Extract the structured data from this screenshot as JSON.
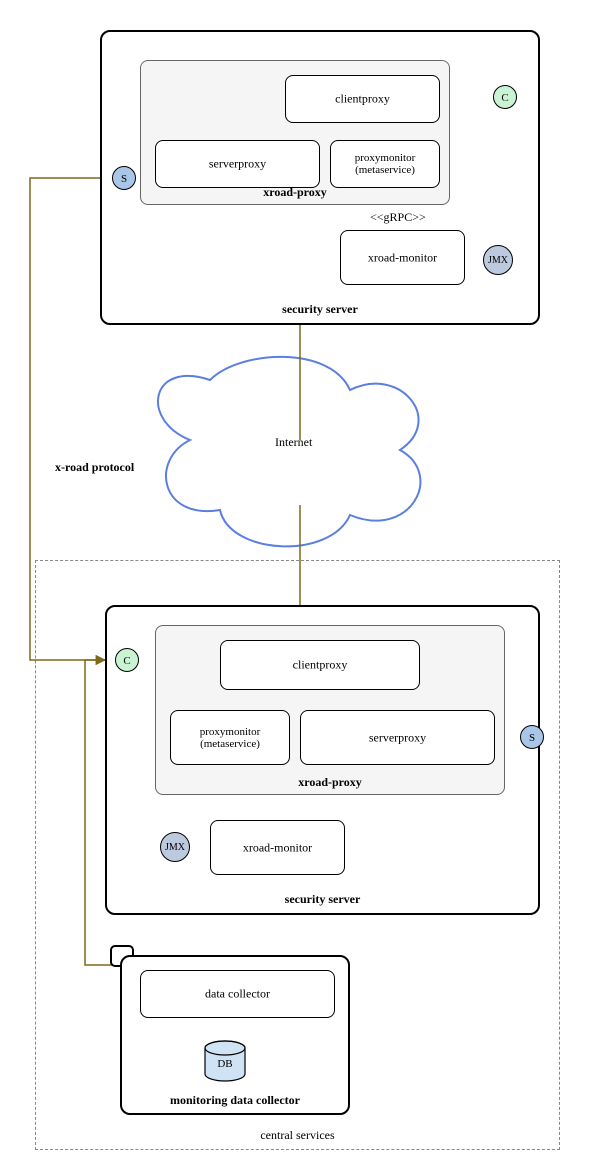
{
  "top_server": {
    "title": "security server",
    "xroad_proxy": {
      "title": "xroad-proxy",
      "clientproxy": "clientproxy",
      "serverproxy": "serverproxy",
      "proxymonitor": "proxymonitor (metaservice)"
    },
    "grpc": "<<gRPC>>",
    "xroad_monitor": "xroad-monitor",
    "ports": {
      "s": "S",
      "c": "C",
      "jmx": "JMX"
    }
  },
  "internet": {
    "label": "Internet"
  },
  "protocol": "x-road protocol",
  "central": {
    "title": "central services",
    "sec_server": {
      "title": "security server",
      "xroad_proxy": {
        "title": "xroad-proxy",
        "clientproxy": "clientproxy",
        "serverproxy": "serverproxy",
        "proxymonitor": "proxymonitor (metaservice)"
      },
      "xroad_monitor": "xroad-monitor",
      "ports": {
        "s": "S",
        "c": "C",
        "jmx": "JMX"
      }
    },
    "collector_node": {
      "title": "monitoring data collector",
      "data_collector": "data collector",
      "db": "DB"
    }
  }
}
